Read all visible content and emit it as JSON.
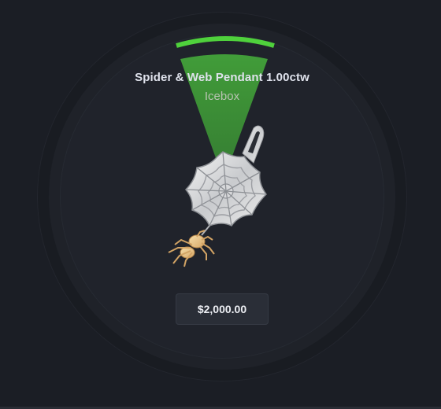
{
  "item": {
    "name": "Spider & Web Pendant 1.00ctw",
    "brand": "Icebox",
    "price": "$2,000.00"
  },
  "indicator": {
    "color": "#4fd13c",
    "wedge_color": "#43a33a"
  },
  "icons": {
    "product": "spider-web-pendant-icon"
  }
}
